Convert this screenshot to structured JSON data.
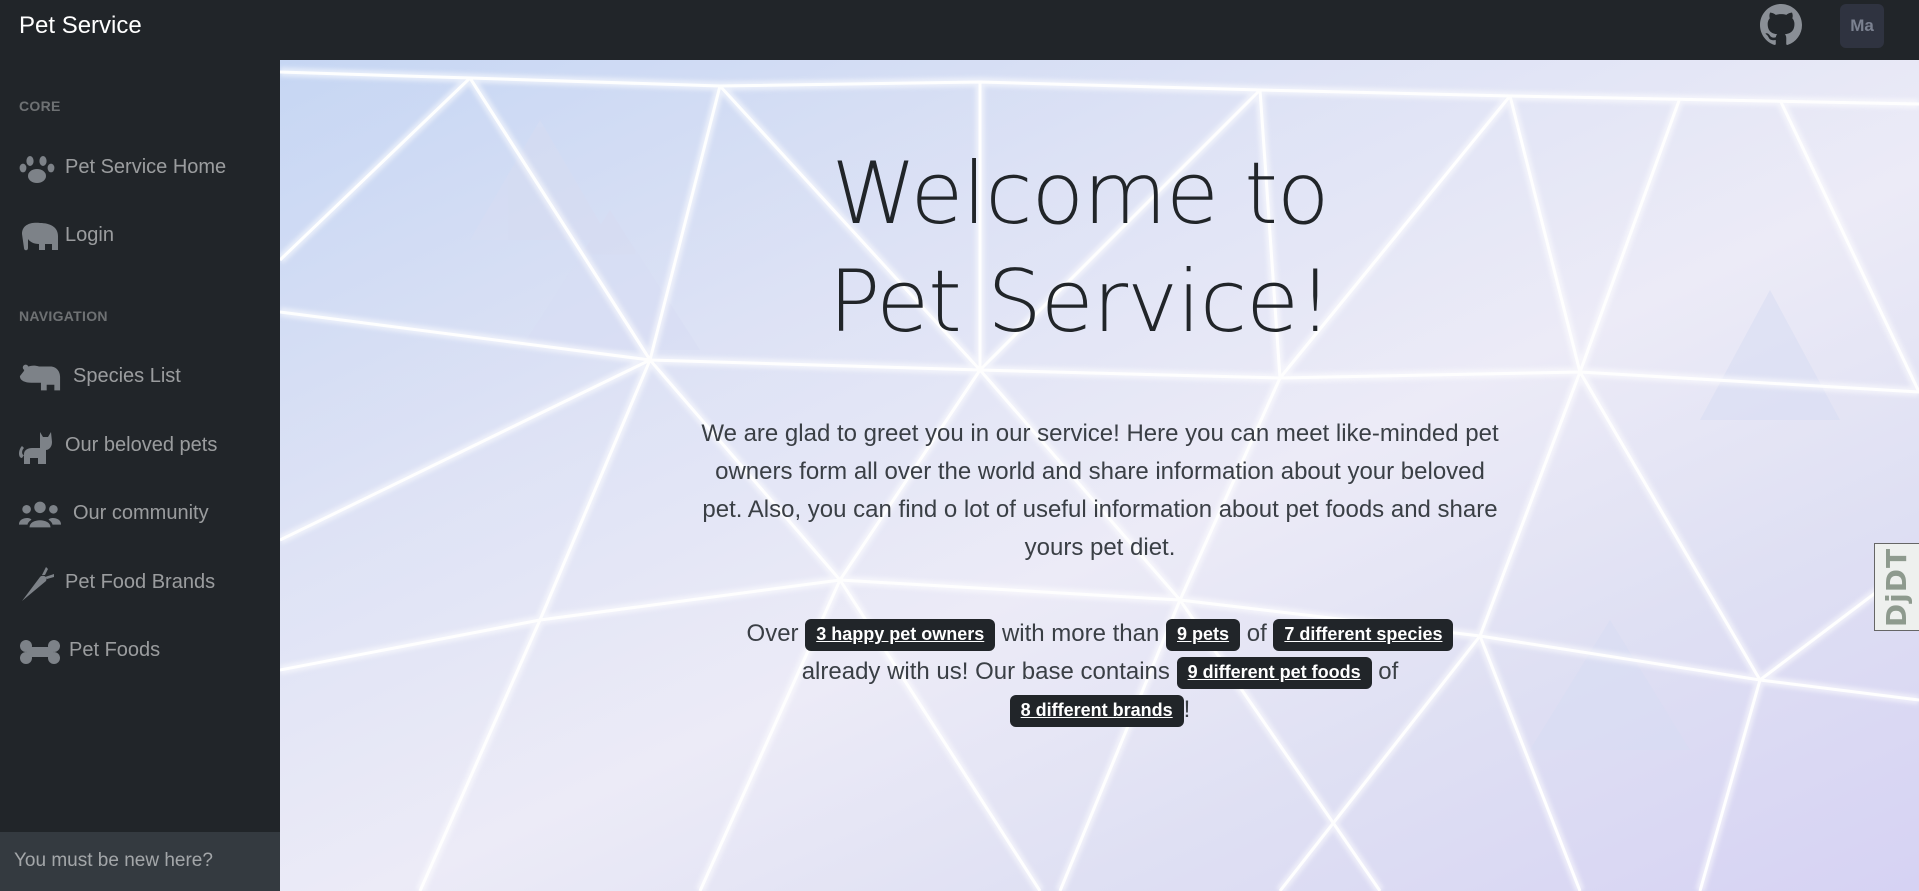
{
  "topbar": {
    "brand": "Pet Service",
    "github_icon": "github-icon",
    "avatar_initials": "Ma"
  },
  "sidebar": {
    "core_heading": "CORE",
    "navigation_heading": "NAVIGATION",
    "items": [
      {
        "label": "Pet Service Home",
        "icon": "paw-icon"
      },
      {
        "label": "Login",
        "icon": "elephant-icon"
      },
      {
        "label": "Species List",
        "icon": "hippo-icon"
      },
      {
        "label": "Our beloved pets",
        "icon": "cat-icon"
      },
      {
        "label": "Our community",
        "icon": "users-icon"
      },
      {
        "label": "Pet Food Brands",
        "icon": "carrot-icon"
      },
      {
        "label": "Pet Foods",
        "icon": "bone-icon"
      }
    ],
    "footer": "You must be new here?"
  },
  "main": {
    "title": "Welcome to Pet Service!",
    "lead": "We are glad to greet you in our service! Here you can meet like-minded pet owners form all over the world and share information about your beloved pet. Also, you can find o lot of useful information about pet foods and share yours pet diet.",
    "stats": {
      "t1": "Over",
      "owners": "3 happy pet owners",
      "t2": "with more than",
      "pets": "9 pets",
      "t3": "of",
      "species": "7 different species",
      "t4": "already with us! Our base contains",
      "foods": "9 different pet foods",
      "t5": "of",
      "brands": "8 different brands",
      "t6": "!"
    }
  },
  "debug_toolbar": {
    "label": "DjDT"
  },
  "colors": {
    "sidebar_bg": "#212529",
    "badge_bg": "#212529",
    "footer_bg": "#343a40"
  }
}
